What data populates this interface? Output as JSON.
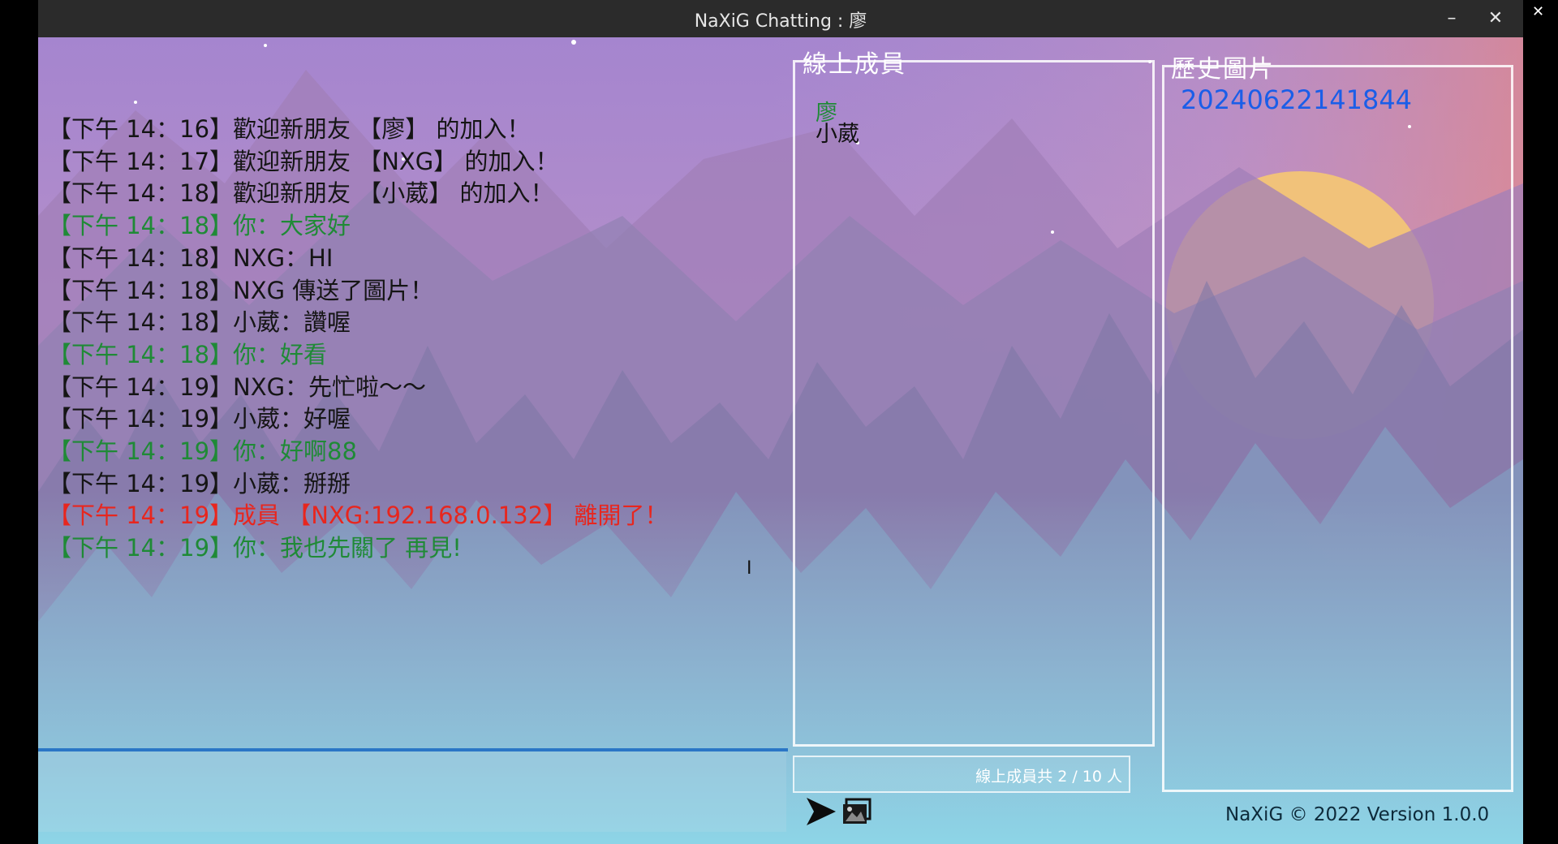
{
  "window": {
    "title": "NaXiG Chatting : 廖",
    "minimize_glyph": "–",
    "close_glyph": "✕",
    "outer_close_glyph": "✕"
  },
  "chat": {
    "messages": [
      {
        "text": "【下午 14：16】歡迎新朋友 【廖】 的加入！",
        "kind": "normal"
      },
      {
        "text": "【下午 14：17】歡迎新朋友 【NXG】 的加入！",
        "kind": "normal"
      },
      {
        "text": "【下午 14：18】歡迎新朋友 【小葳】 的加入！",
        "kind": "normal"
      },
      {
        "text": "【下午 14：18】你：大家好",
        "kind": "self"
      },
      {
        "text": "【下午 14：18】NXG：HI",
        "kind": "normal"
      },
      {
        "text": "【下午 14：18】NXG 傳送了圖片！",
        "kind": "normal"
      },
      {
        "text": "【下午 14：18】小葳：讚喔",
        "kind": "normal"
      },
      {
        "text": "【下午 14：18】你：好看",
        "kind": "self"
      },
      {
        "text": "【下午 14：19】NXG：先忙啦～～",
        "kind": "normal"
      },
      {
        "text": "【下午 14：19】小葳：好喔",
        "kind": "normal"
      },
      {
        "text": "【下午 14：19】你：好啊88",
        "kind": "self"
      },
      {
        "text": "【下午 14：19】小葳：掰掰",
        "kind": "normal"
      },
      {
        "text": "【下午 14：19】成員 【NXG:192.168.0.132】 離開了！",
        "kind": "system"
      },
      {
        "text": "【下午 14：19】你：我也先關了 再見!",
        "kind": "self"
      }
    ],
    "input_value": ""
  },
  "members_panel": {
    "title": "線上成員",
    "members": [
      {
        "name": "廖",
        "color": "#1f8a36"
      },
      {
        "name": "小葳",
        "color": "#111111"
      }
    ],
    "count_text": "線上成員共 2 / 10 人"
  },
  "history_panel": {
    "title": "歷史圖片",
    "items": [
      "20240622141844"
    ]
  },
  "toolbar": {
    "send_icon": "send-arrow-icon",
    "image_icon": "picture-icon"
  },
  "footer": {
    "text": "NaXiG © 2022  Version 1.0.0"
  },
  "colors": {
    "self_message": "#1f8a36",
    "system_message": "#e8261e",
    "history_link": "#1a5ee8",
    "divider": "#2a76c6"
  }
}
